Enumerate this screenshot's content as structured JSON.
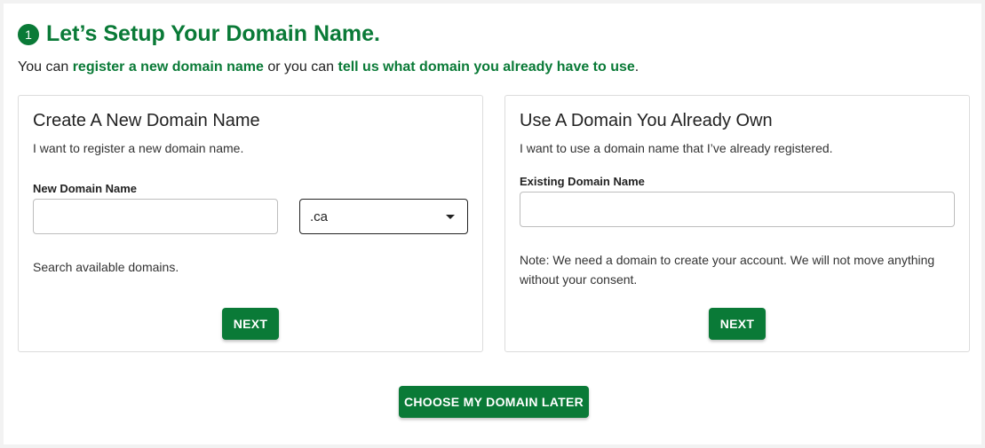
{
  "heading": {
    "step": "1",
    "title": "Let’s Setup Your Domain Name."
  },
  "intro": {
    "prefix": "You can ",
    "link_register": "register a new domain name",
    "middle": " or you can ",
    "link_existing": "tell us what domain you already have to use",
    "suffix": "."
  },
  "new_domain_card": {
    "title": "Create A New Domain Name",
    "description": "I want to register a new domain name.",
    "field_label": "New Domain Name",
    "input_value": "",
    "tld_selected": ".ca",
    "helper": "Search available domains.",
    "next_label": "NEXT"
  },
  "existing_domain_card": {
    "title": "Use A Domain You Already Own",
    "description": "I want to use a domain name that I’ve already registered.",
    "field_label": "Existing Domain Name",
    "input_value": "",
    "note": "Note: We need a domain to create your account. We will not move anything without your consent.",
    "next_label": "NEXT"
  },
  "choose_later_label": "CHOOSE MY DOMAIN LATER",
  "colors": {
    "brand_green": "#0a7a37",
    "card_border": "#dcdcdc"
  }
}
